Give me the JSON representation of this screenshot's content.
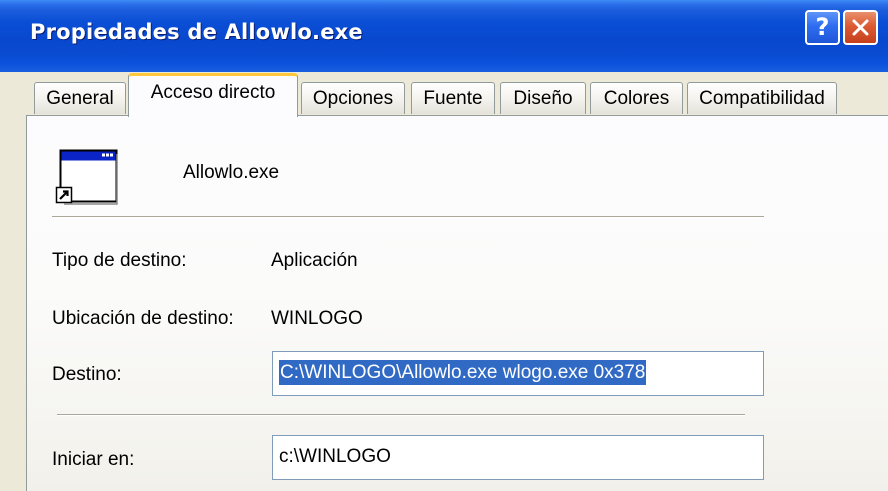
{
  "window": {
    "title": "Propiedades de Allowlo.exe",
    "help_button": "?",
    "close_button_icon": "close-icon"
  },
  "tabs": [
    {
      "label": "General",
      "active": false
    },
    {
      "label": "Acceso directo",
      "active": true
    },
    {
      "label": "Opciones",
      "active": false
    },
    {
      "label": "Fuente",
      "active": false
    },
    {
      "label": "Diseño",
      "active": false
    },
    {
      "label": "Colores",
      "active": false
    },
    {
      "label": "Compatibilidad",
      "active": false
    }
  ],
  "shortcut": {
    "icon": "application-shortcut-icon",
    "filename": "Allowlo.exe"
  },
  "fields": {
    "target_type_label": "Tipo de destino:",
    "target_type_value": "Aplicación",
    "target_location_label": "Ubicación de destino:",
    "target_location_value": "WINLOGO",
    "target_label": "Destino:",
    "target_value": "C:\\WINLOGO\\Allowlo.exe wlogo.exe 0x378",
    "start_in_label": "Iniciar en:",
    "start_in_value": "c:\\WINLOGO"
  },
  "colors": {
    "titlebar": "#0a4fd6",
    "selection": "#316ac5",
    "active_tab_accent": "#ffc83c",
    "close_button": "#dc5b33"
  }
}
